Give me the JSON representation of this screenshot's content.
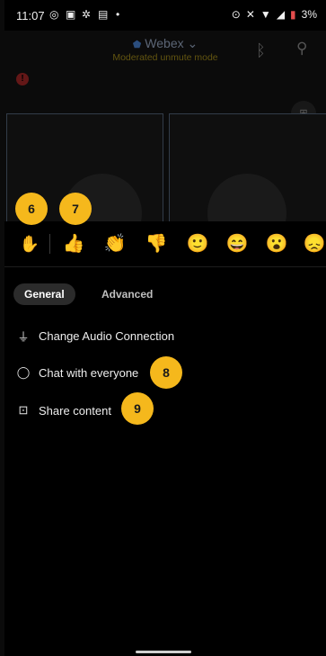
{
  "status_bar": {
    "time": "11:07",
    "battery": "3%"
  },
  "meeting": {
    "app_title": "Webex",
    "subtitle": "Moderated unmute mode",
    "alert_count": "!"
  },
  "reactions": {
    "raise_hand": "✋",
    "items": [
      {
        "name": "thumbs-up",
        "glyph": "👍"
      },
      {
        "name": "clap",
        "glyph": "👏"
      },
      {
        "name": "thumbs-down",
        "glyph": "👎"
      },
      {
        "name": "smile",
        "glyph": "🙂"
      },
      {
        "name": "laugh",
        "glyph": "😄"
      },
      {
        "name": "surprised",
        "glyph": "😮"
      },
      {
        "name": "sad",
        "glyph": "😞"
      }
    ]
  },
  "tabs": {
    "general": "General",
    "advanced": "Advanced"
  },
  "menu": {
    "change_audio": "Change Audio Connection",
    "chat": "Chat with everyone",
    "share": "Share content"
  },
  "badges": {
    "b6": "6",
    "b7": "7",
    "b8": "8",
    "b9": "9"
  }
}
